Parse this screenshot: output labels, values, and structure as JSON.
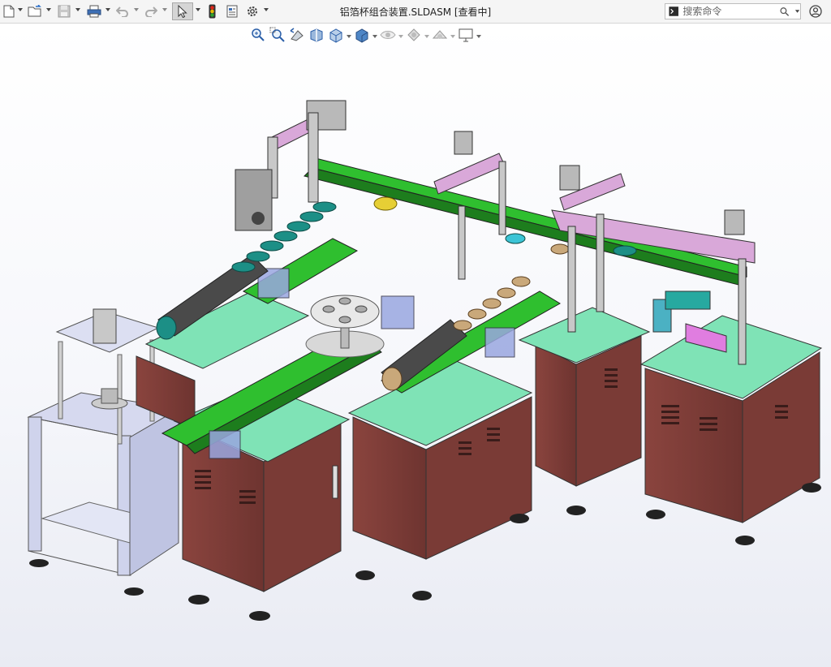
{
  "app": {
    "document_title": "铝箔杯组合装置.SLDASM [查看中]"
  },
  "toolbar": {
    "buttons": [
      {
        "id": "new",
        "icon": "new-document-icon"
      },
      {
        "id": "open",
        "icon": "open-folder-icon"
      },
      {
        "id": "save",
        "icon": "save-icon"
      },
      {
        "id": "print",
        "icon": "print-icon"
      },
      {
        "id": "undo",
        "icon": "undo-icon"
      },
      {
        "id": "redo",
        "icon": "redo-icon"
      },
      {
        "id": "select",
        "icon": "select-cursor-icon"
      },
      {
        "id": "rebuild",
        "icon": "rebuild-traffic-light-icon"
      },
      {
        "id": "file-properties",
        "icon": "file-properties-icon"
      },
      {
        "id": "options",
        "icon": "gear-icon"
      }
    ]
  },
  "search": {
    "placeholder": "搜索命令"
  },
  "view_toolbar": {
    "buttons": [
      {
        "id": "zoom-to-fit",
        "icon": "zoom-to-fit-icon"
      },
      {
        "id": "zoom-to-area",
        "icon": "zoom-to-area-icon"
      },
      {
        "id": "previous-view",
        "icon": "previous-view-icon"
      },
      {
        "id": "section-view",
        "icon": "section-view-icon"
      },
      {
        "id": "view-orientation",
        "icon": "view-orientation-icon"
      },
      {
        "id": "display-style",
        "icon": "display-style-icon"
      },
      {
        "id": "hide-show-items",
        "icon": "hide-show-eye-icon"
      },
      {
        "id": "edit-appearance",
        "icon": "edit-appearance-icon"
      },
      {
        "id": "apply-scene",
        "icon": "apply-scene-icon"
      },
      {
        "id": "view-settings",
        "icon": "monitor-icon"
      }
    ]
  },
  "colors": {
    "cabinet": "#7a3b36",
    "table_top": "#7fe3b6",
    "conveyor": "#2fbf2f",
    "frame": "#c7cbe6",
    "gantry": "#d9a8d9",
    "cups": "#1c8f86"
  }
}
